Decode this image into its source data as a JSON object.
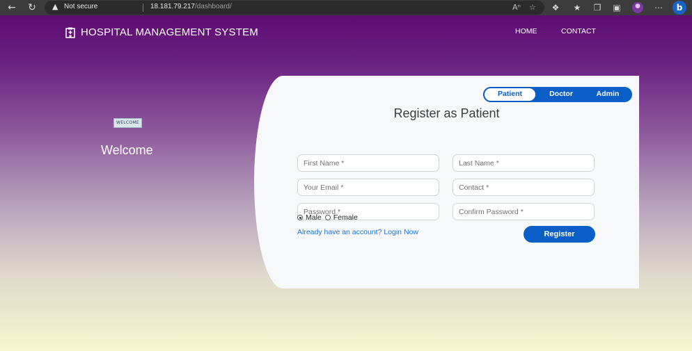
{
  "browser": {
    "security_label": "Not secure",
    "url_host": "18.181.79.217",
    "url_path": "/dashboard/"
  },
  "header": {
    "brand": "HOSPITAL MANAGEMENT SYSTEM",
    "nav": [
      "HOME",
      "CONTACT"
    ]
  },
  "welcome": {
    "image_label": "WELCOME",
    "text": "Welcome"
  },
  "form": {
    "tabs": [
      "Patient",
      "Doctor",
      "Admin"
    ],
    "active_tab": "Patient",
    "title": "Register as Patient",
    "fields": {
      "first_name": "First Name *",
      "last_name": "Last Name *",
      "email": "Your Email *",
      "contact": "Contact *",
      "password": "Password *",
      "confirm_password": "Confirm Password *"
    },
    "gender_options": [
      "Male",
      "Female"
    ],
    "gender_selected": "Male",
    "login_link": "Already have an account? Login Now",
    "submit_label": "Register"
  },
  "colors": {
    "primary": "#0a5ec8",
    "header_purple": "#5e0d73",
    "bottom_cream": "#f7f6cf"
  }
}
